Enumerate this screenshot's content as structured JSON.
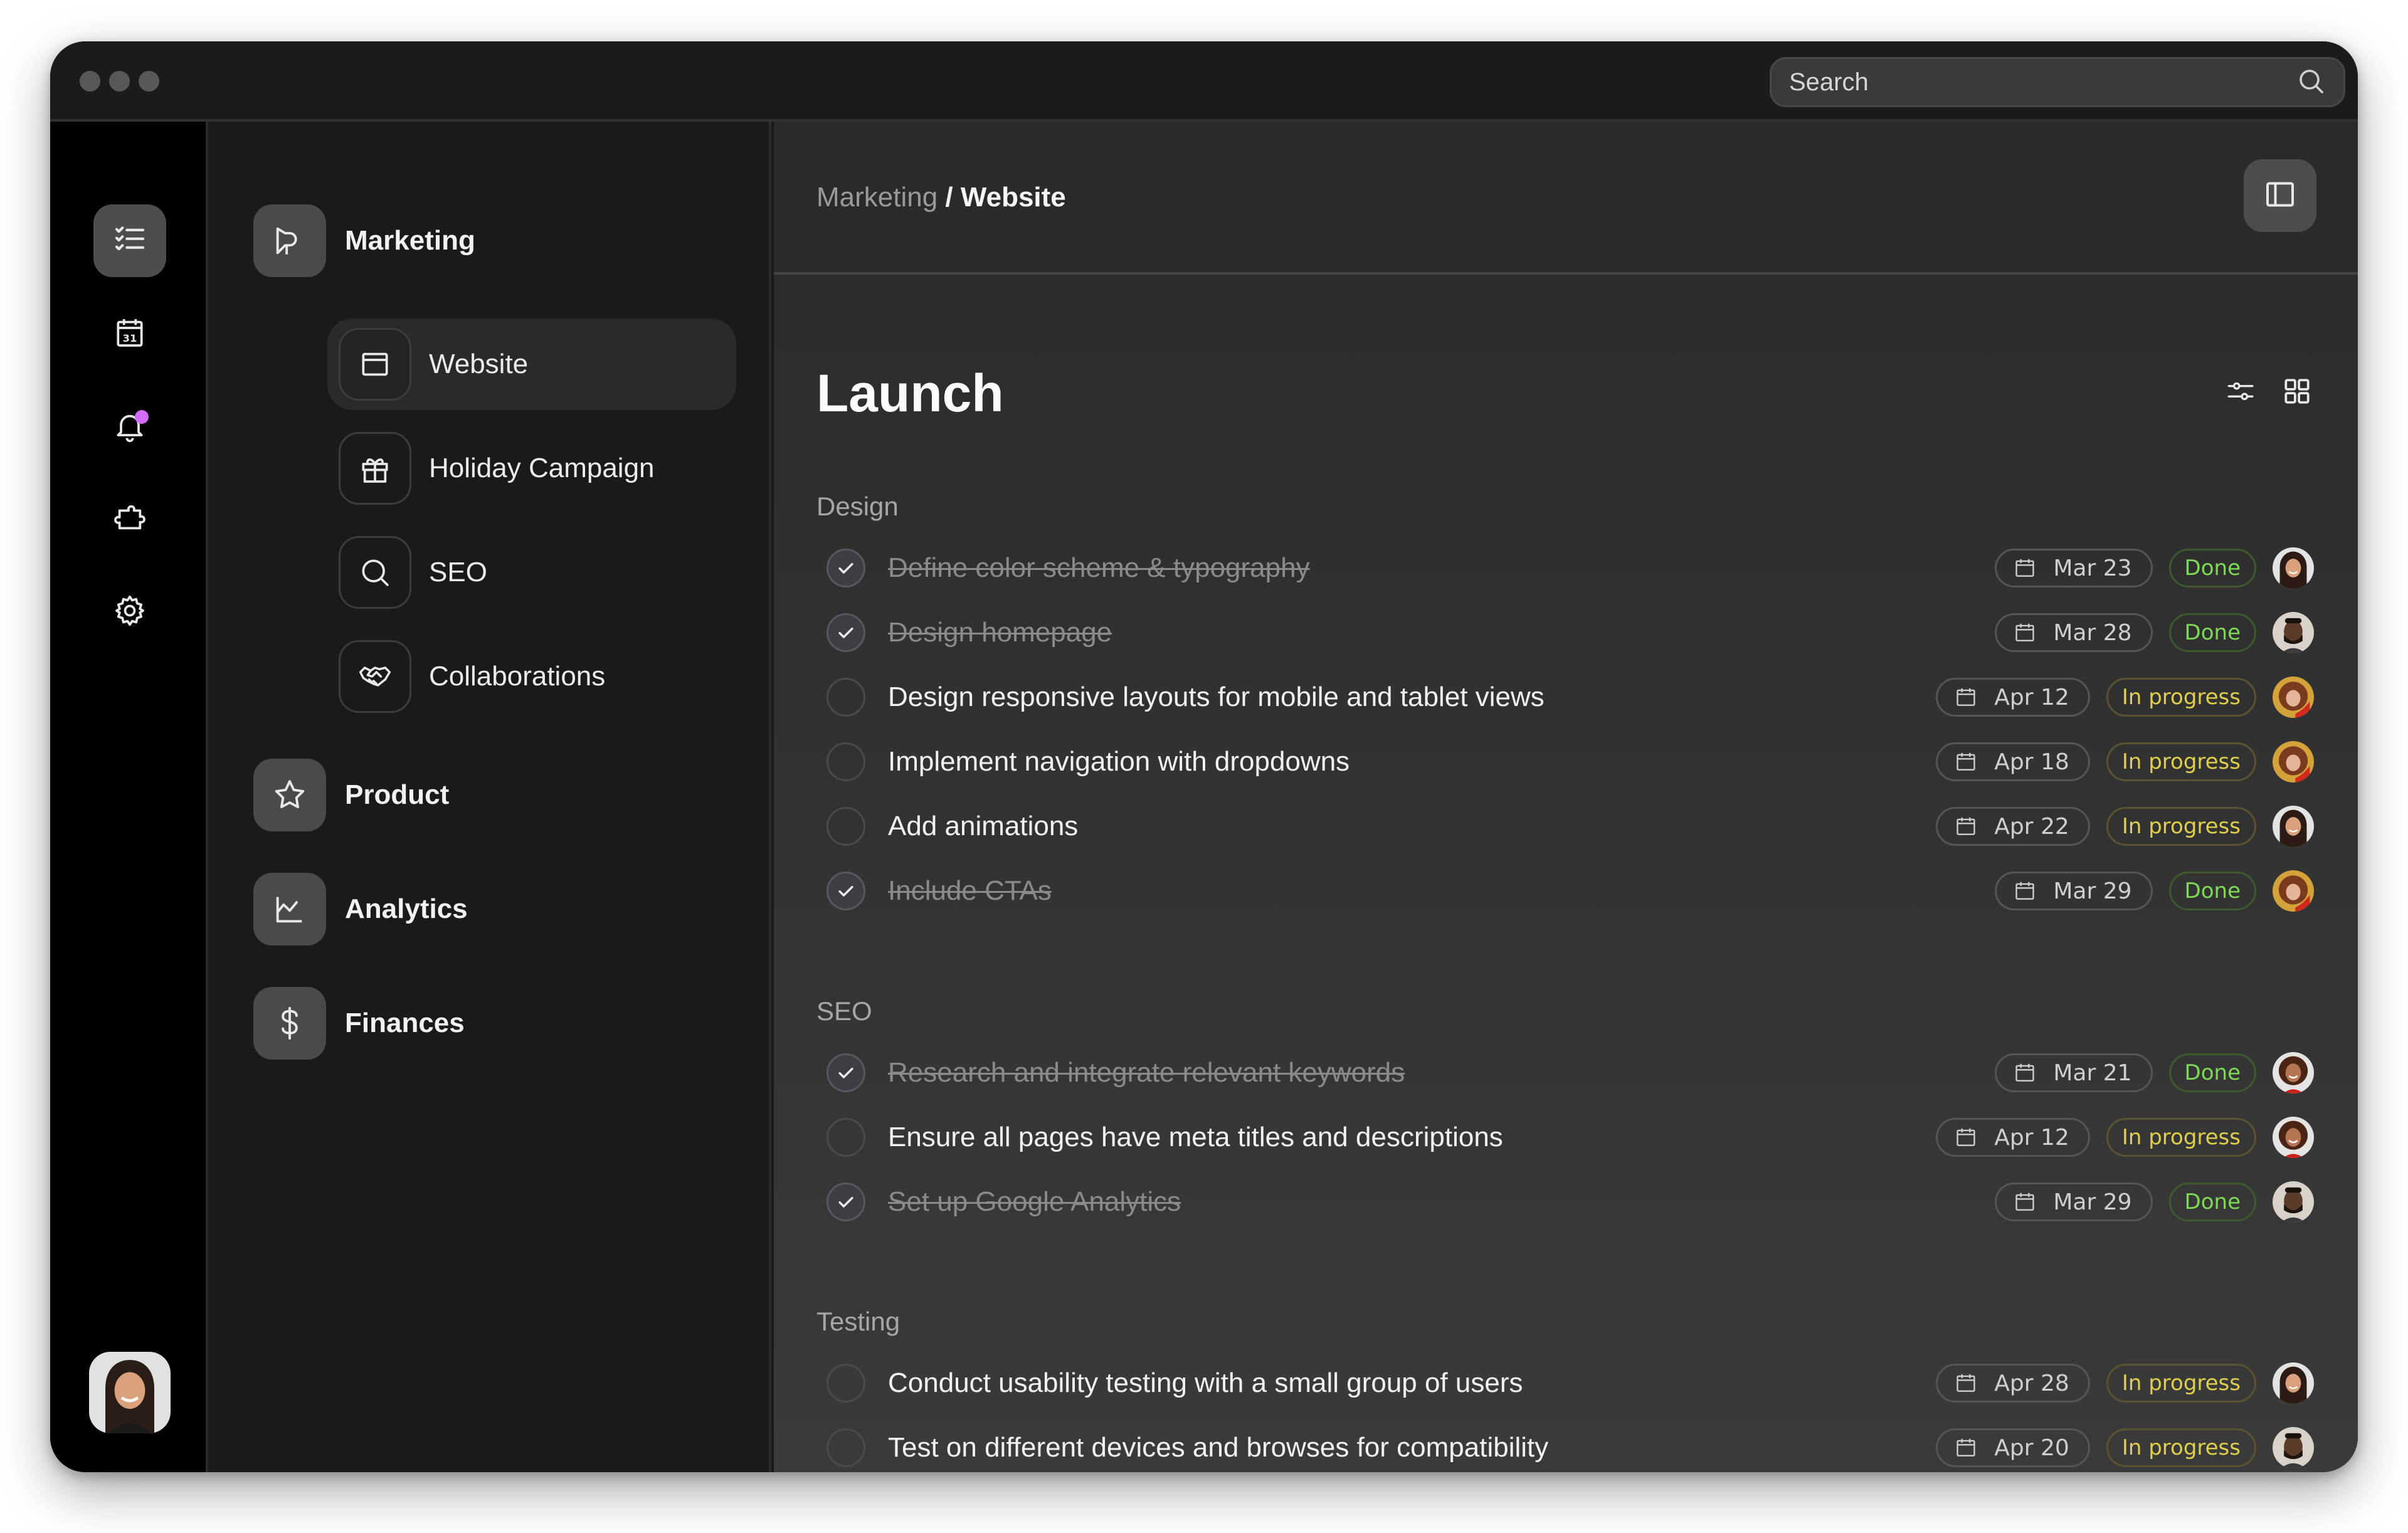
{
  "window": {
    "search_placeholder": "Search"
  },
  "rail": {
    "items": [
      {
        "icon": "checklist-icon",
        "active": true
      },
      {
        "icon": "calendar-icon",
        "active": false
      },
      {
        "icon": "bell-icon",
        "active": false,
        "notification": true
      },
      {
        "icon": "puzzle-icon",
        "active": false
      },
      {
        "icon": "gear-icon",
        "active": false
      }
    ],
    "notification_color": "#d36cf6"
  },
  "nav": {
    "groups": [
      {
        "label": "Marketing",
        "icon": "megaphone-icon"
      },
      {
        "label": "Product",
        "icon": "star-icon"
      },
      {
        "label": "Analytics",
        "icon": "line-chart-icon"
      },
      {
        "label": "Finances",
        "icon": "dollar-icon"
      }
    ],
    "marketing_items": [
      {
        "label": "Website",
        "icon": "browser-window-icon",
        "active": true
      },
      {
        "label": "Holiday Campaign",
        "icon": "gift-icon",
        "active": false
      },
      {
        "label": "SEO",
        "icon": "search-icon",
        "active": false
      },
      {
        "label": "Collaborations",
        "icon": "handshake-icon",
        "active": false
      }
    ]
  },
  "header": {
    "breadcrumb_parent": "Marketing",
    "breadcrumb_separator": " / ",
    "breadcrumb_current": "Website"
  },
  "main": {
    "title": "Launch",
    "sections": [
      {
        "label": "Design",
        "tasks": [
          {
            "title": "Define color scheme & typography",
            "done": true,
            "date": "Mar 23",
            "status": "Done",
            "assignee": "woman-dark-hair"
          },
          {
            "title": "Design homepage",
            "done": true,
            "date": "Mar 28",
            "status": "Done",
            "assignee": "man-beard"
          },
          {
            "title": "Design responsive layouts for mobile and tablet views",
            "done": false,
            "date": "Apr 12",
            "status": "In progress",
            "assignee": "woman-red-curly"
          },
          {
            "title": "Implement navigation with dropdowns",
            "done": false,
            "date": "Apr 18",
            "status": "In progress",
            "assignee": "woman-red-curly"
          },
          {
            "title": "Add animations",
            "done": false,
            "date": "Apr 22",
            "status": "In progress",
            "assignee": "woman-dark-hair"
          },
          {
            "title": "Include CTAs",
            "done": true,
            "date": "Mar 29",
            "status": "Done",
            "assignee": "woman-red-curly"
          }
        ]
      },
      {
        "label": "SEO",
        "tasks": [
          {
            "title": "Research and integrate relevant keywords",
            "done": true,
            "date": "Mar 21",
            "status": "Done",
            "assignee": "woman-curly-smile"
          },
          {
            "title": "Ensure all pages have meta titles and descriptions",
            "done": false,
            "date": "Apr 12",
            "status": "In progress",
            "assignee": "woman-curly-smile"
          },
          {
            "title": "Set up Google Analytics",
            "done": true,
            "date": "Mar 29",
            "status": "Done",
            "assignee": "man-beard"
          }
        ]
      },
      {
        "label": "Testing",
        "tasks": [
          {
            "title": "Conduct usability testing with a small group of users",
            "done": false,
            "date": "Apr 28",
            "status": "In progress",
            "assignee": "woman-dark-hair"
          },
          {
            "title": "Test on different devices and browses for compatibility",
            "done": false,
            "date": "Apr 20",
            "status": "In progress",
            "assignee": "man-beard"
          }
        ]
      }
    ]
  },
  "colors": {
    "done": "#7ed957",
    "in_progress": "#e0cf4a"
  }
}
